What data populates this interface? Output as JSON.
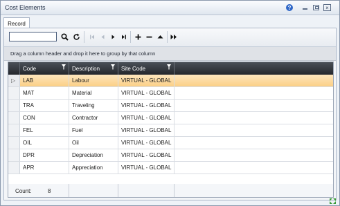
{
  "window": {
    "title": "Cost Elements",
    "help_icon": "?",
    "close_icon": "×"
  },
  "tabs": [
    {
      "label": "Record",
      "active": true
    }
  ],
  "toolbar": {
    "search_value": "",
    "search_placeholder": "",
    "icons": [
      "search-icon",
      "refresh-icon",
      "first-icon",
      "prev-icon",
      "next-icon",
      "last-icon",
      "add-icon",
      "remove-icon",
      "up-icon",
      "more-icon"
    ]
  },
  "group_bar": {
    "text": "Drag a column header and drop it here to group by that column"
  },
  "grid": {
    "columns": [
      {
        "label": "Code"
      },
      {
        "label": "Description"
      },
      {
        "label": "Site Code"
      }
    ],
    "rows": [
      {
        "code": "LAB",
        "description": "Labour",
        "site_code": "VIRTUAL - GLOBAL",
        "selected": true
      },
      {
        "code": "MAT",
        "description": "Material",
        "site_code": "VIRTUAL - GLOBAL"
      },
      {
        "code": "TRA",
        "description": "Traveling",
        "site_code": "VIRTUAL - GLOBAL"
      },
      {
        "code": "CON",
        "description": "Contractor",
        "site_code": "VIRTUAL - GLOBAL"
      },
      {
        "code": "FEL",
        "description": "Fuel",
        "site_code": "VIRTUAL - GLOBAL"
      },
      {
        "code": "OIL",
        "description": "Oil",
        "site_code": "VIRTUAL - GLOBAL"
      },
      {
        "code": "DPR",
        "description": "Depreciation",
        "site_code": "VIRTUAL - GLOBAL"
      },
      {
        "code": "APR",
        "description": "Appreciation",
        "site_code": "VIRTUAL - GLOBAL"
      }
    ],
    "footer": {
      "count_label": "Count:",
      "count_value": "8"
    }
  },
  "colors": {
    "header_bg": "#2c3036",
    "selected_row": "#fbd99a",
    "help_icon": "#2f67c7"
  }
}
